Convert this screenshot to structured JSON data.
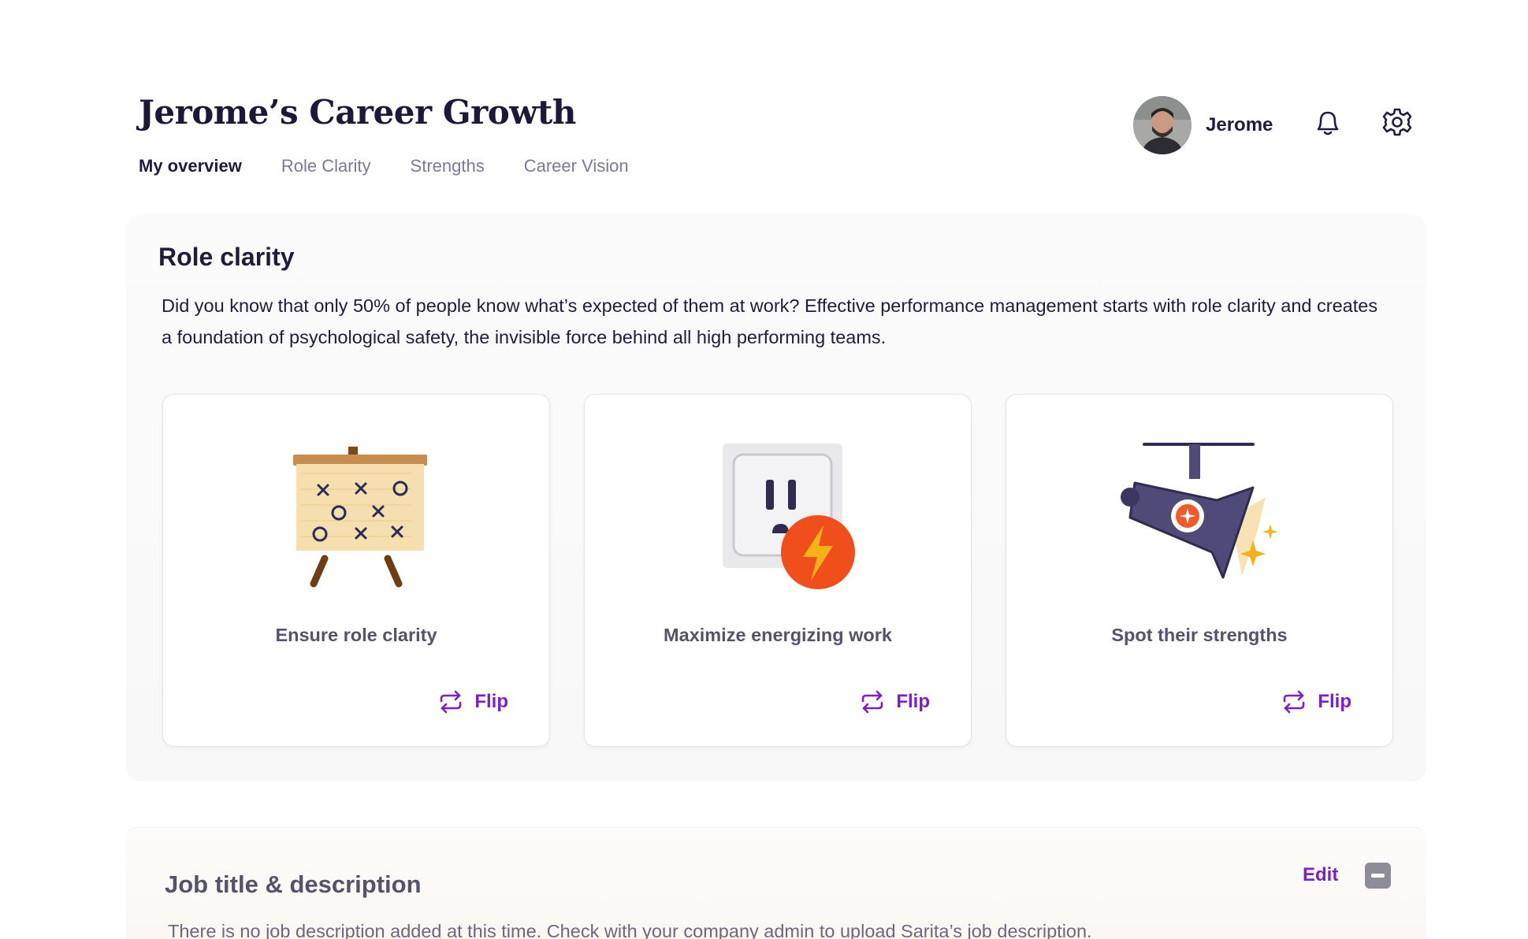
{
  "header": {
    "title": "Jerome’s Career Growth",
    "tabs": [
      {
        "label": "My overview",
        "active": true
      },
      {
        "label": "Role Clarity",
        "active": false
      },
      {
        "label": "Strengths",
        "active": false
      },
      {
        "label": "Career Vision",
        "active": false
      }
    ],
    "user_name": "Jerome",
    "icons": [
      "bell-icon",
      "gear-icon"
    ]
  },
  "role_clarity": {
    "title": "Role clarity",
    "description": "Did you know that only 50% of people know what’s expected of them at work? Effective performance management starts with role clarity and creates a foundation of psychological safety, the invisible force behind all high performing teams.",
    "cards": [
      {
        "label": "Ensure role clarity",
        "illustration": "strategy-board-icon",
        "flip_label": "Flip"
      },
      {
        "label": "Maximize energizing work",
        "illustration": "power-outlet-icon",
        "flip_label": "Flip"
      },
      {
        "label": "Spot their strengths",
        "illustration": "spotlight-icon",
        "flip_label": "Flip"
      }
    ]
  },
  "job": {
    "title": "Job title & description",
    "edit_label": "Edit",
    "description": "There is no job description added at this time. Check with your company admin to upload Sarita’s job description."
  },
  "colors": {
    "accent": "#7a1fc9",
    "heading": "#1f1d3a",
    "muted": "#7c7991"
  }
}
